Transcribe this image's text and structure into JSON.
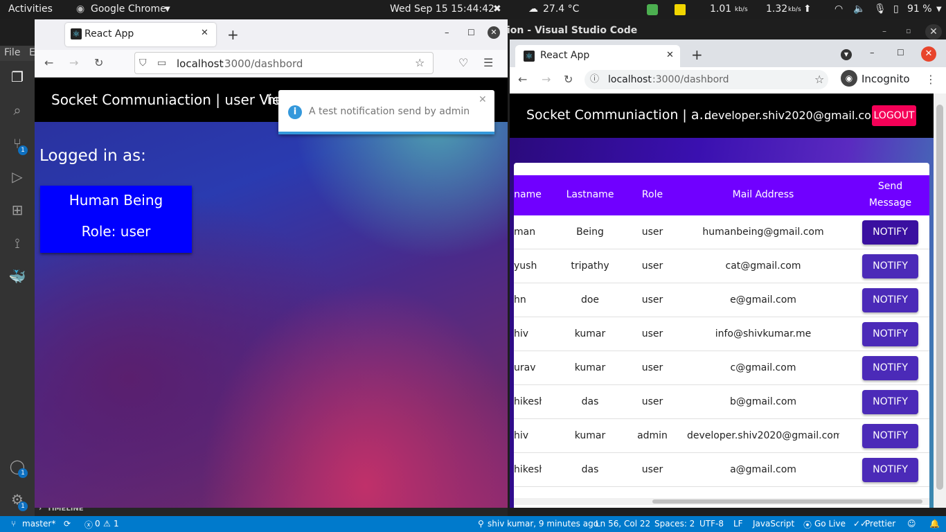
{
  "topbar": {
    "activities": "Activities",
    "app_name": "Google Chrome",
    "datetime": "Wed Sep 15  15:44:42",
    "weather": "27.4 °C",
    "net_down": "1.01",
    "net_down_unit": "kb/s",
    "net_up": "1.32",
    "net_up_unit": "kb/s",
    "battery": "91 %"
  },
  "vscode": {
    "title": "ion - Visual Studio Code",
    "menu_file": "File",
    "menu_edit": "E",
    "bottom_panel": "TIMELINE",
    "badges": {
      "source_control": "1",
      "accounts": "1",
      "settings": "1"
    }
  },
  "statusbar": {
    "branch": "master*",
    "problems": "0",
    "warnings": "1",
    "blame": "shiv kumar, 9 minutes ago",
    "position": "Ln 56, Col 22",
    "spaces": "Spaces: 2",
    "encoding": "UTF-8",
    "eol": "LF",
    "language": "JavaScript",
    "golive": "Go Live",
    "prettier": "Prettier"
  },
  "firefox": {
    "tab_title": "React App",
    "url_host": "localhost",
    "url_path": ":3000/dashbord",
    "header_title": "Socket Communiaction | user View",
    "header_user_fragment": "hu",
    "toast_text": "A test notification send by admin",
    "logged_in_label": "Logged in as:",
    "user_name": "Human Being",
    "user_role": "Role: user"
  },
  "chrome": {
    "tab_title": "React App",
    "url_host": "localhost",
    "url_path": ":3000/dashbord",
    "incognito": "Incognito",
    "header_title": "Socket Communiaction | a…",
    "header_email": "developer.shiv2020@gmail.com",
    "logout": "LOGOUT",
    "table": {
      "headers": {
        "firstname": "name",
        "lastname": "Lastname",
        "role": "Role",
        "mail": "Mail Address",
        "send1": "Send",
        "send2": "Message"
      },
      "rows": [
        {
          "first": "man",
          "last": "Being",
          "role": "user",
          "mail": "humanbeing@gmail.com",
          "btn": "NOTIFY"
        },
        {
          "first": "yush",
          "last": "tripathy",
          "role": "user",
          "mail": "cat@gmail.com",
          "btn": "NOTIFY"
        },
        {
          "first": "hn",
          "last": "doe",
          "role": "user",
          "mail": "e@gmail.com",
          "btn": "NOTIFY"
        },
        {
          "first": "hiv",
          "last": "kumar",
          "role": "user",
          "mail": "info@shivkumar.me",
          "btn": "NOTIFY"
        },
        {
          "first": "urav",
          "last": "kumar",
          "role": "user",
          "mail": "c@gmail.com",
          "btn": "NOTIFY"
        },
        {
          "first": "hikesh",
          "last": "das",
          "role": "user",
          "mail": "b@gmail.com",
          "btn": "NOTIFY"
        },
        {
          "first": "hiv",
          "last": "kumar",
          "role": "admin",
          "mail": "developer.shiv2020@gmail.com",
          "btn": "NOTIFY"
        },
        {
          "first": "hikesh",
          "last": "das",
          "role": "user",
          "mail": "a@gmail.com",
          "btn": "NOTIFY"
        }
      ]
    }
  },
  "colors": {
    "table_header": "#7000ff",
    "notify_button": "#4b2ab8",
    "logout_button": "#f50057",
    "user_card": "#0000ff",
    "statusbar": "#007acc"
  }
}
